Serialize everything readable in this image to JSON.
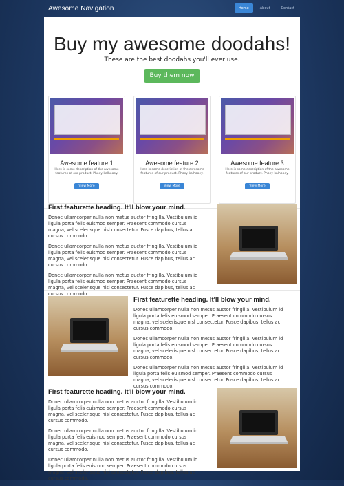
{
  "navbar": {
    "brand": "Awesome Navigation",
    "links": [
      "Home",
      "About",
      "Contact"
    ],
    "active_index": 0
  },
  "hero": {
    "title": "Buy my awesome doodahs!",
    "subtitle": "These are the best doodahs you'll ever use.",
    "cta_label": "Buy them now"
  },
  "features": [
    {
      "title": "Awesome feature 1",
      "desc": "Here is some description of the awesome features of our product. Phoey kalhooey.",
      "button": "View More"
    },
    {
      "title": "Awesome feature 2",
      "desc": "Here is some description of the awesome features of our product. Phoey kalhooey.",
      "button": "View More"
    },
    {
      "title": "Awesome feature 3",
      "desc": "Here is some description of the awesome features of our product. Phoey kalhooey.",
      "button": "View More"
    }
  ],
  "featurettes": [
    {
      "heading": "First featurette heading. It'll blow your mind.",
      "paragraphs": [
        "Donec ullamcorper nulla non metus auctor fringilla. Vestibulum id ligula porta felis euismod semper. Praesent commodo cursus magna, vel scelerisque nisl consectetur. Fusce dapibus, tellus ac cursus commodo.",
        "Donec ullamcorper nulla non metus auctor fringilla. Vestibulum id ligula porta felis euismod semper. Praesent commodo cursus magna, vel scelerisque nisl consectetur. Fusce dapibus, tellus ac cursus commodo.",
        "Donec ullamcorper nulla non metus auctor fringilla. Vestibulum id ligula porta felis euismod semper. Praesent commodo cursus magna, vel scelerisque nisl consectetur. Fusce dapibus, tellus ac cursus commodo."
      ]
    },
    {
      "heading": "First featurette heading. It'll blow your mind.",
      "paragraphs": [
        "Donec ullamcorper nulla non metus auctor fringilla. Vestibulum id ligula porta felis euismod semper. Praesent commodo cursus magna, vel scelerisque nisl consectetur. Fusce dapibus, tellus ac cursus commodo.",
        "Donec ullamcorper nulla non metus auctor fringilla. Vestibulum id ligula porta felis euismod semper. Praesent commodo cursus magna, vel scelerisque nisl consectetur. Fusce dapibus, tellus ac cursus commodo.",
        "Donec ullamcorper nulla non metus auctor fringilla. Vestibulum id ligula porta felis euismod semper. Praesent commodo cursus magna, vel scelerisque nisl consectetur. Fusce dapibus, tellus ac cursus commodo."
      ]
    },
    {
      "heading": "First featurette heading. It'll blow your mind.",
      "paragraphs": [
        "Donec ullamcorper nulla non metus auctor fringilla. Vestibulum id ligula porta felis euismod semper. Praesent commodo cursus magna, vel scelerisque nisl consectetur. Fusce dapibus, tellus ac cursus commodo.",
        "Donec ullamcorper nulla non metus auctor fringilla. Vestibulum id ligula porta felis euismod semper. Praesent commodo cursus magna, vel scelerisque nisl consectetur. Fusce dapibus, tellus ac cursus commodo.",
        "Donec ullamcorper nulla non metus auctor fringilla. Vestibulum id ligula porta felis euismod semper. Praesent commodo cursus magna, vel scelerisque nisl consectetur. Fusce dapibus, tellus ac cursus commodo."
      ]
    }
  ],
  "colors": {
    "background": "#1f3b66",
    "accent": "#3a86d6",
    "cta": "#5cb85c"
  }
}
